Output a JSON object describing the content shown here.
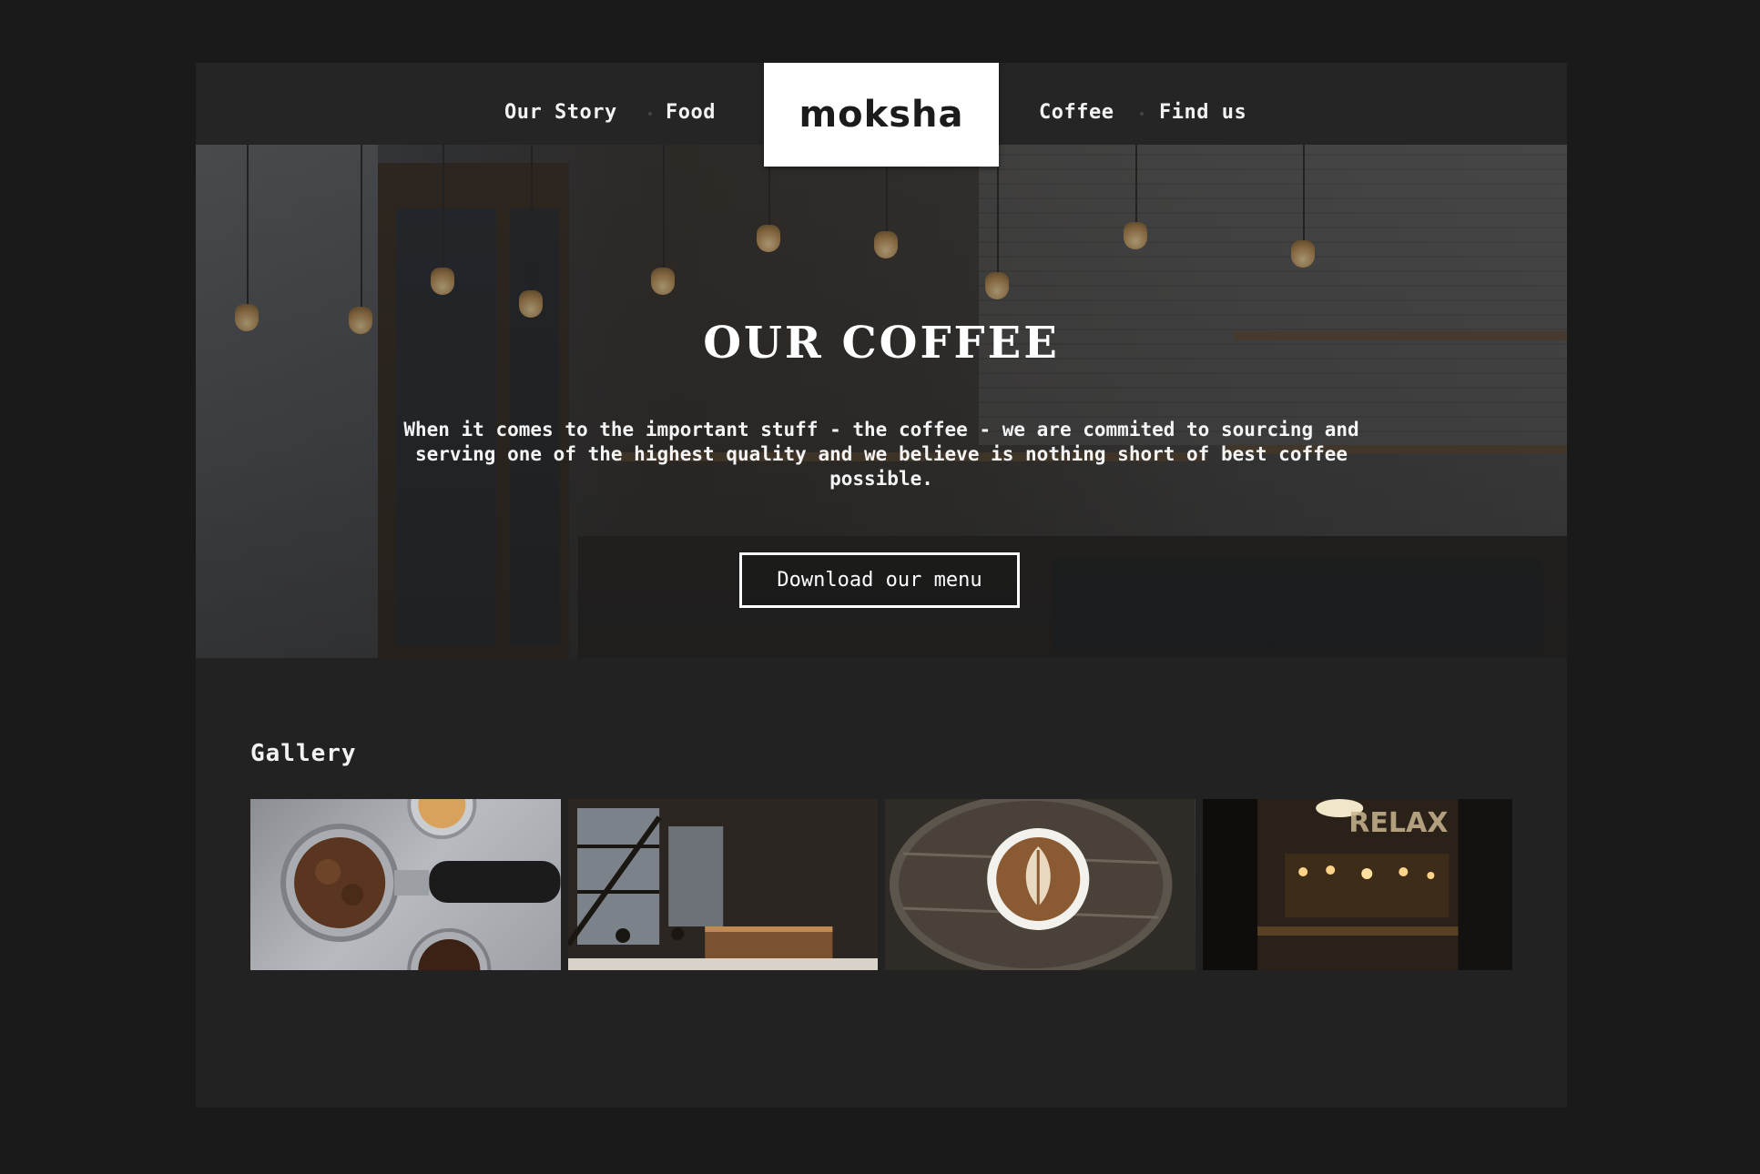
{
  "nav": {
    "left_links": [
      "Our Story",
      "Food"
    ],
    "right_links": [
      "Coffee",
      "Find us"
    ],
    "logo": "moksha"
  },
  "hero": {
    "title": "OUR COFFEE",
    "text": "When it comes to the important stuff - the coffee - we are commited to sourcing and serving one of the highest quality and we believe is nothing short of best coffee possible.",
    "button_label": "Download our menu"
  },
  "gallery": {
    "title": "Gallery",
    "images": [
      "coffee-grounds-portafilter",
      "cafe-interior",
      "latte-art-cup",
      "relax-bar"
    ]
  },
  "colors": {
    "background": "#1a1a1a",
    "page": "#222222",
    "nav": "#252525",
    "logo_bg": "#ffffff",
    "text": "#f2f2f2"
  }
}
